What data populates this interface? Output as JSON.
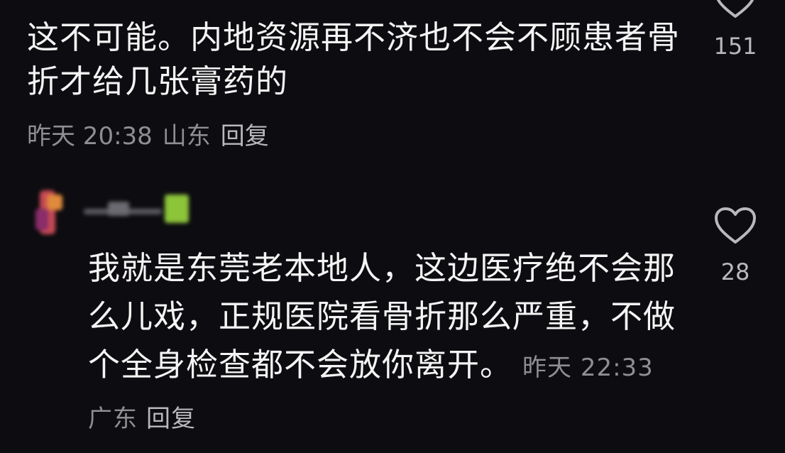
{
  "comments": [
    {
      "text": "这不可能。内地资源再不济也不会不顾患者骨折才给几张膏药的",
      "time": "昨天 20:38",
      "location": "山东",
      "reply_label": "回复",
      "like_count": "151",
      "like_icon": "heart-outline-icon"
    },
    {
      "text": "我就是东莞老本地人，这边医疗绝不会那么儿戏，正规医院看骨折那么严重，不做个全身检查都不会放你离开。",
      "time": "昨天 22:33",
      "location": "广东",
      "reply_label": "回复",
      "like_count": "28",
      "like_icon": "heart-outline-icon",
      "avatar": "blurred",
      "username": "blurred"
    }
  ],
  "colors": {
    "background": "#0d0c10",
    "text": "#f4f4f4",
    "meta": "#8e8e93",
    "icon": "#b9b9bd"
  }
}
